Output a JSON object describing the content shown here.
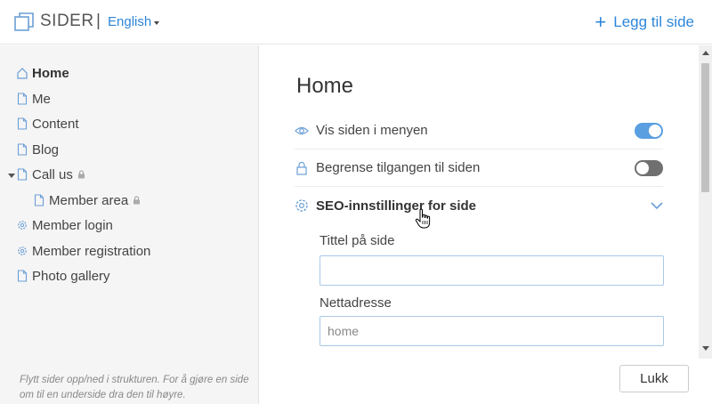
{
  "header": {
    "app_title": "SIDER",
    "separator": "|",
    "language": "English",
    "add_page": "Legg til side",
    "add_icon": "plus-icon"
  },
  "sidebar": {
    "items": [
      {
        "label": "Home",
        "icon": "home-icon",
        "active": true
      },
      {
        "label": "Me",
        "icon": "page-icon"
      },
      {
        "label": "Content",
        "icon": "page-icon"
      },
      {
        "label": "Blog",
        "icon": "page-icon"
      },
      {
        "label": "Call us",
        "icon": "page-icon",
        "locked": true,
        "expanded": true
      },
      {
        "label": "Member area",
        "icon": "page-icon",
        "locked": true,
        "child": true
      },
      {
        "label": "Member login",
        "icon": "gear-icon"
      },
      {
        "label": "Member registration",
        "icon": "gear-icon"
      },
      {
        "label": "Photo gallery",
        "icon": "page-icon"
      }
    ],
    "hint": "Flytt sider opp/ned i strukturen. For å gjøre en side om til en underside dra den til høyre."
  },
  "main": {
    "title": "Home",
    "settings": [
      {
        "label": "Vis siden i menyen",
        "icon": "eye-icon",
        "control": "toggle",
        "state": "on"
      },
      {
        "label": "Begrense tilgangen til siden",
        "icon": "lock-icon",
        "control": "toggle",
        "state": "off"
      },
      {
        "label": "SEO-innstillinger for side",
        "icon": "gear-icon",
        "control": "chevron",
        "state": "expanded"
      }
    ],
    "fields": {
      "page_title_label": "Tittel på side",
      "page_title_value": "",
      "url_label": "Nettadresse",
      "url_placeholder": "home"
    },
    "close_button": "Lukk"
  },
  "colors": {
    "accent": "#2e86d9",
    "toggle_on": "#5a9fe0",
    "toggle_off": "#707070",
    "sidebar_bg": "#f5f5f5"
  }
}
